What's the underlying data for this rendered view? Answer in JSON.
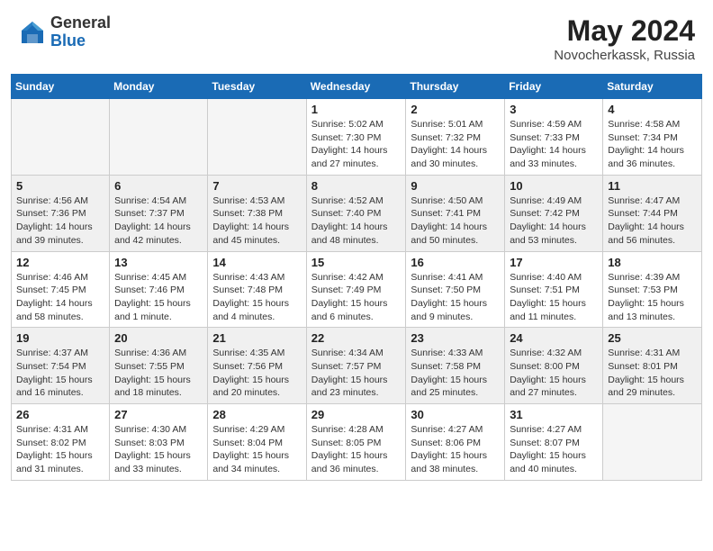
{
  "header": {
    "logo_general": "General",
    "logo_blue": "Blue",
    "month_year": "May 2024",
    "location": "Novocherkassk, Russia"
  },
  "days_of_week": [
    "Sunday",
    "Monday",
    "Tuesday",
    "Wednesday",
    "Thursday",
    "Friday",
    "Saturday"
  ],
  "weeks": [
    [
      {
        "day": "",
        "info": ""
      },
      {
        "day": "",
        "info": ""
      },
      {
        "day": "",
        "info": ""
      },
      {
        "day": "1",
        "info": "Sunrise: 5:02 AM\nSunset: 7:30 PM\nDaylight: 14 hours\nand 27 minutes."
      },
      {
        "day": "2",
        "info": "Sunrise: 5:01 AM\nSunset: 7:32 PM\nDaylight: 14 hours\nand 30 minutes."
      },
      {
        "day": "3",
        "info": "Sunrise: 4:59 AM\nSunset: 7:33 PM\nDaylight: 14 hours\nand 33 minutes."
      },
      {
        "day": "4",
        "info": "Sunrise: 4:58 AM\nSunset: 7:34 PM\nDaylight: 14 hours\nand 36 minutes."
      }
    ],
    [
      {
        "day": "5",
        "info": "Sunrise: 4:56 AM\nSunset: 7:36 PM\nDaylight: 14 hours\nand 39 minutes."
      },
      {
        "day": "6",
        "info": "Sunrise: 4:54 AM\nSunset: 7:37 PM\nDaylight: 14 hours\nand 42 minutes."
      },
      {
        "day": "7",
        "info": "Sunrise: 4:53 AM\nSunset: 7:38 PM\nDaylight: 14 hours\nand 45 minutes."
      },
      {
        "day": "8",
        "info": "Sunrise: 4:52 AM\nSunset: 7:40 PM\nDaylight: 14 hours\nand 48 minutes."
      },
      {
        "day": "9",
        "info": "Sunrise: 4:50 AM\nSunset: 7:41 PM\nDaylight: 14 hours\nand 50 minutes."
      },
      {
        "day": "10",
        "info": "Sunrise: 4:49 AM\nSunset: 7:42 PM\nDaylight: 14 hours\nand 53 minutes."
      },
      {
        "day": "11",
        "info": "Sunrise: 4:47 AM\nSunset: 7:44 PM\nDaylight: 14 hours\nand 56 minutes."
      }
    ],
    [
      {
        "day": "12",
        "info": "Sunrise: 4:46 AM\nSunset: 7:45 PM\nDaylight: 14 hours\nand 58 minutes."
      },
      {
        "day": "13",
        "info": "Sunrise: 4:45 AM\nSunset: 7:46 PM\nDaylight: 15 hours\nand 1 minute."
      },
      {
        "day": "14",
        "info": "Sunrise: 4:43 AM\nSunset: 7:48 PM\nDaylight: 15 hours\nand 4 minutes."
      },
      {
        "day": "15",
        "info": "Sunrise: 4:42 AM\nSunset: 7:49 PM\nDaylight: 15 hours\nand 6 minutes."
      },
      {
        "day": "16",
        "info": "Sunrise: 4:41 AM\nSunset: 7:50 PM\nDaylight: 15 hours\nand 9 minutes."
      },
      {
        "day": "17",
        "info": "Sunrise: 4:40 AM\nSunset: 7:51 PM\nDaylight: 15 hours\nand 11 minutes."
      },
      {
        "day": "18",
        "info": "Sunrise: 4:39 AM\nSunset: 7:53 PM\nDaylight: 15 hours\nand 13 minutes."
      }
    ],
    [
      {
        "day": "19",
        "info": "Sunrise: 4:37 AM\nSunset: 7:54 PM\nDaylight: 15 hours\nand 16 minutes."
      },
      {
        "day": "20",
        "info": "Sunrise: 4:36 AM\nSunset: 7:55 PM\nDaylight: 15 hours\nand 18 minutes."
      },
      {
        "day": "21",
        "info": "Sunrise: 4:35 AM\nSunset: 7:56 PM\nDaylight: 15 hours\nand 20 minutes."
      },
      {
        "day": "22",
        "info": "Sunrise: 4:34 AM\nSunset: 7:57 PM\nDaylight: 15 hours\nand 23 minutes."
      },
      {
        "day": "23",
        "info": "Sunrise: 4:33 AM\nSunset: 7:58 PM\nDaylight: 15 hours\nand 25 minutes."
      },
      {
        "day": "24",
        "info": "Sunrise: 4:32 AM\nSunset: 8:00 PM\nDaylight: 15 hours\nand 27 minutes."
      },
      {
        "day": "25",
        "info": "Sunrise: 4:31 AM\nSunset: 8:01 PM\nDaylight: 15 hours\nand 29 minutes."
      }
    ],
    [
      {
        "day": "26",
        "info": "Sunrise: 4:31 AM\nSunset: 8:02 PM\nDaylight: 15 hours\nand 31 minutes."
      },
      {
        "day": "27",
        "info": "Sunrise: 4:30 AM\nSunset: 8:03 PM\nDaylight: 15 hours\nand 33 minutes."
      },
      {
        "day": "28",
        "info": "Sunrise: 4:29 AM\nSunset: 8:04 PM\nDaylight: 15 hours\nand 34 minutes."
      },
      {
        "day": "29",
        "info": "Sunrise: 4:28 AM\nSunset: 8:05 PM\nDaylight: 15 hours\nand 36 minutes."
      },
      {
        "day": "30",
        "info": "Sunrise: 4:27 AM\nSunset: 8:06 PM\nDaylight: 15 hours\nand 38 minutes."
      },
      {
        "day": "31",
        "info": "Sunrise: 4:27 AM\nSunset: 8:07 PM\nDaylight: 15 hours\nand 40 minutes."
      },
      {
        "day": "",
        "info": ""
      }
    ]
  ]
}
